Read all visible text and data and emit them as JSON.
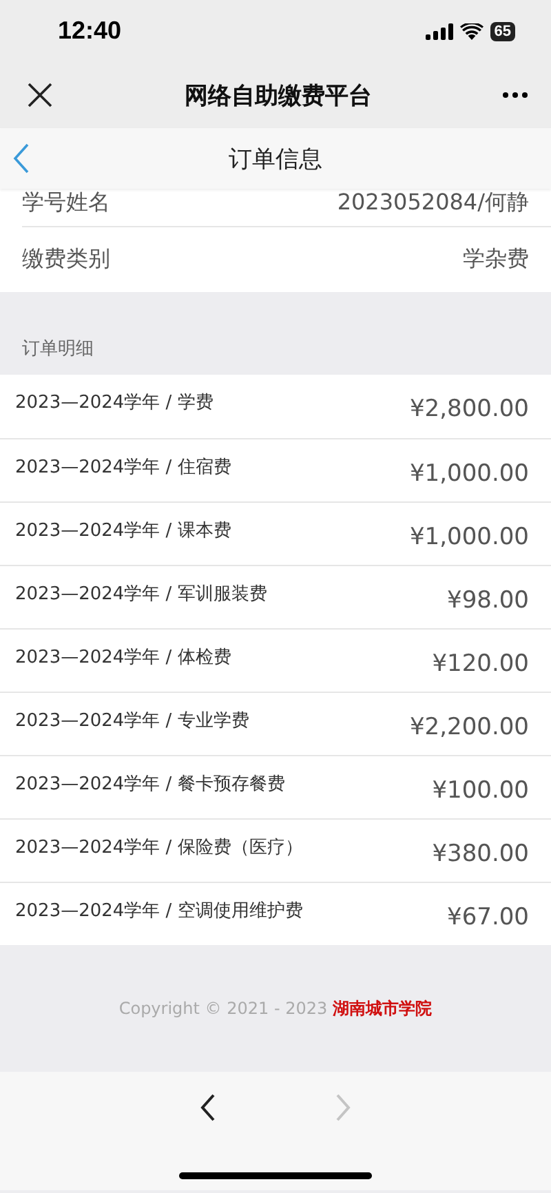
{
  "status_bar": {
    "time": "12:40",
    "battery": "65"
  },
  "nav_bar": {
    "title": "网络自助缴费平台"
  },
  "header": {
    "title": "订单信息"
  },
  "info": [
    {
      "label": "学号姓名",
      "value": "2023052084/何静"
    },
    {
      "label": "缴费类别",
      "value": "学杂费"
    }
  ],
  "details": {
    "title": "订单明细",
    "items": [
      {
        "name": "2023—2024学年 / 学费",
        "amount": "¥2,800.00"
      },
      {
        "name": "2023—2024学年 / 住宿费",
        "amount": "¥1,000.00"
      },
      {
        "name": "2023—2024学年 / 课本费",
        "amount": "¥1,000.00"
      },
      {
        "name": "2023—2024学年 / 军训服装费",
        "amount": "¥98.00"
      },
      {
        "name": "2023—2024学年 / 体检费",
        "amount": "¥120.00"
      },
      {
        "name": "2023—2024学年 / 专业学费",
        "amount": "¥2,200.00"
      },
      {
        "name": "2023—2024学年 / 餐卡预存餐费",
        "amount": "¥100.00"
      },
      {
        "name": "2023—2024学年 / 保险费（医疗）",
        "amount": "¥380.00"
      },
      {
        "name": "2023—2024学年 / 空调使用维护费",
        "amount": "¥67.00"
      }
    ]
  },
  "footer": {
    "copyright": "Copyright © 2021 - 2023",
    "school": "湖南城市学院"
  },
  "toolbar": {
    "back": {
      "disabled": false
    },
    "forward": {
      "disabled": true
    }
  }
}
